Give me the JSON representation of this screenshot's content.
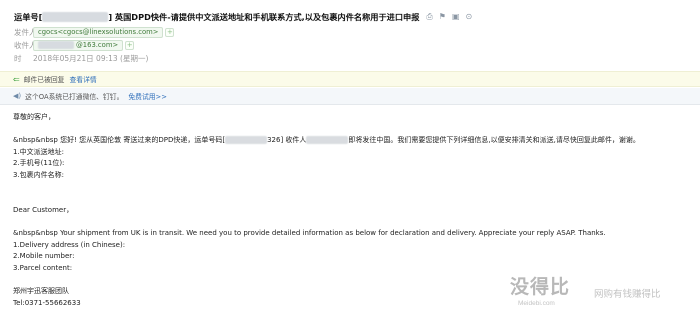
{
  "header": {
    "subject_prefix": "运单号[",
    "subject_suffix": "] 英国DPD快件-请提供中文派送地址和手机联系方式,以及包裹内件名称用于进口申报",
    "icons": [
      "print-icon",
      "flag-icon",
      "mark-icon",
      "more-icon"
    ],
    "sender_label": "发件人：",
    "sender_value": "cgocs<cgocs@linexsolutions.com>",
    "recipient_label": "收件人：",
    "recipient_value": "@163.com>",
    "time_label": "时",
    "time_value": "2018年05月21日 09:13 (星期一)"
  },
  "notices": {
    "reply_text": "邮件已被回复",
    "reply_link": "查看详情",
    "oa_text": "这个OA系统已打通微信、钉钉。",
    "oa_link": "免费试用>>"
  },
  "body": {
    "greeting": "尊敬的客户，",
    "cn_para_part1": "&nbsp&nbsp 您好! 您从英国伦敦 寄送过来的DPD快递，运单号码[",
    "cn_para_part2": "326] 收件人",
    "cn_para_part3": "即将发往中国。我们需要您提供下列详细信息,以便安排清关和派送,请尽快回复此邮件，谢谢。",
    "cn_item1": "1.中文派送地址:",
    "cn_item2": "2.手机号(11位):",
    "cn_item3": "3.包裹内件名称:",
    "en_greeting": "Dear Customer，",
    "en_para": "&nbsp&nbsp Your shipment from UK is in transit. We need you to provide detailed information as below for declaration and delivery. Appreciate your reply ASAP. Thanks.",
    "en_item1": "1.Delivery address (in Chinese):",
    "en_item2": "2.Mobile number:",
    "en_item3": "3.Parcel content:",
    "sign_team": "郑州宇迅客服团队",
    "sign_tel": "Tel:0371-55662633"
  },
  "watermark": {
    "main": "没得比",
    "sub": "Meidebi.com",
    "slogan": "网购有钱赚得比"
  },
  "colors": {
    "reply_bar": "#fbfbe9",
    "oa_bar": "#f4f7fa",
    "link": "#2f6fba",
    "chip_text": "#3f7a3a"
  }
}
